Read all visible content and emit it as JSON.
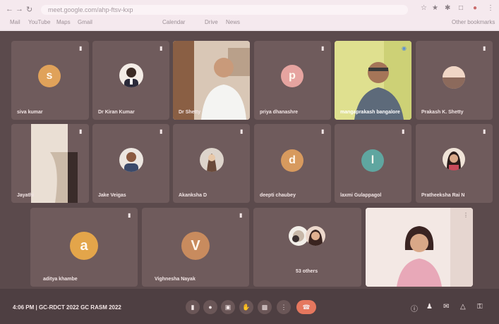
{
  "browser": {
    "url": "meet.google.com/ahp-ftsv-kxp",
    "bookmarks": [
      "Mail",
      "YouTube",
      "Maps",
      "Gmail",
      "Calendar",
      "Drive",
      "News"
    ],
    "other_bookmarks": "Other bookmarks"
  },
  "meeting": {
    "time": "4:06 PM",
    "separator": "|",
    "title": "GC-RDCT 2022 GC RASM 2022"
  },
  "participants": [
    {
      "name": "siva kumar",
      "initial": "s",
      "avatar_color": "#e0a25a"
    },
    {
      "name": "Dr Kiran Kumar",
      "initial": "",
      "avatar_color": ""
    },
    {
      "name": "Dr Shetty",
      "initial": "",
      "avatar_color": ""
    },
    {
      "name": "priya dhanashre",
      "initial": "p",
      "avatar_color": "#e6a4a0"
    },
    {
      "name": "mangaprakash bangalore",
      "initial": "",
      "avatar_color": ""
    },
    {
      "name": "Prakash K. Shetty",
      "initial": "",
      "avatar_color": ""
    },
    {
      "name": "Jayathi",
      "initial": "",
      "avatar_color": ""
    },
    {
      "name": "Jake Veigas",
      "initial": "",
      "avatar_color": ""
    },
    {
      "name": "Akanksha D",
      "initial": "",
      "avatar_color": ""
    },
    {
      "name": "deepti chaubey",
      "initial": "d",
      "avatar_color": "#d79a5e"
    },
    {
      "name": "laxmi Gulappagol",
      "initial": "l",
      "avatar_color": "#5fa6a0"
    },
    {
      "name": "Pratheeksha Rai N",
      "initial": "",
      "avatar_color": ""
    },
    {
      "name": "aditya khambe",
      "initial": "a",
      "avatar_color": "#e3a54a"
    },
    {
      "name": "Vighnesha Nayak",
      "initial": "V",
      "avatar_color": "#c88b5e"
    },
    {
      "name": "53 others",
      "initial": "",
      "avatar_color": ""
    },
    {
      "name": "",
      "initial": "",
      "avatar_color": ""
    }
  ],
  "colors": {
    "meet_bg": "#5b4a4c",
    "tile_bg": "#6f5b5c",
    "hangup": "#e5775e",
    "self_view": "#f2e6e2"
  }
}
